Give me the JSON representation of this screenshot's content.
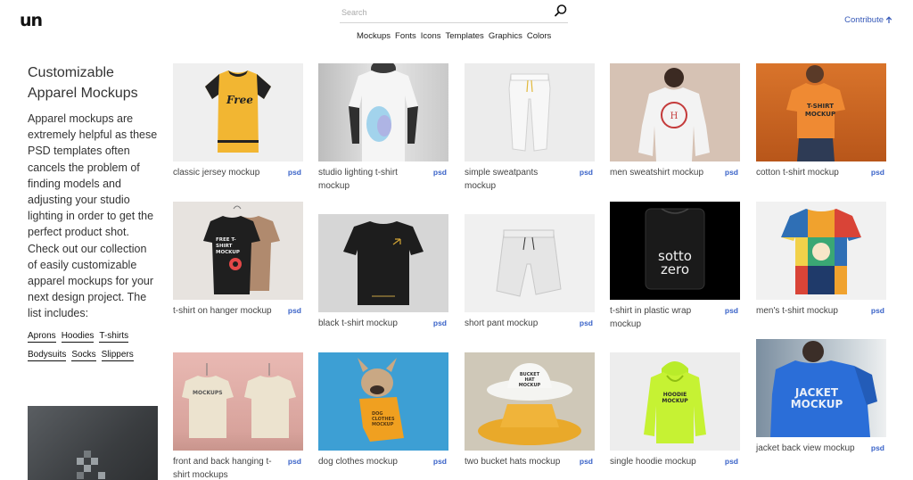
{
  "header": {
    "logo": "un",
    "search_placeholder": "Search",
    "nav": [
      "Mockups",
      "Fonts",
      "Icons",
      "Templates",
      "Graphics",
      "Colors"
    ],
    "contribute": "Contribute"
  },
  "sidebar": {
    "title": "Customizable Apparel Mockups",
    "description": "Apparel mockups are extremely helpful as these PSD templates often cancels the problem of finding models and adjusting your studio lighting in order to get the perfect product shot. Check out our collection of easily customizable apparel mockups for your next design project. The list includes:",
    "tags": [
      "Aprons",
      "Hoodies",
      "T-shirts",
      "Bodysuits",
      "Socks",
      "Slippers"
    ]
  },
  "grid": {
    "badge": "psd",
    "items": [
      {
        "caption": "classic jersey mockup",
        "print": "Free"
      },
      {
        "caption": "studio lighting t-shirt mockup",
        "print": ""
      },
      {
        "caption": "simple sweatpants mockup",
        "print": ""
      },
      {
        "caption": "men sweatshirt mockup",
        "print": ""
      },
      {
        "caption": "cotton t-shirt mockup",
        "print": "T-SHIRT MOCKUP"
      },
      {
        "caption": "t-shirt on hanger mockup",
        "print": "FREE T-SHIRT MOCKUP"
      },
      {
        "caption": "black t-shirt mockup",
        "print": ""
      },
      {
        "caption": "short pant mockup",
        "print": ""
      },
      {
        "caption": "t-shirt in plastic wrap mockup",
        "print": "sotto zero"
      },
      {
        "caption": "men's t-shirt mockup",
        "print": ""
      },
      {
        "caption": "front and back hanging t-shirt mockups",
        "print": "MOCKUPS"
      },
      {
        "caption": "dog clothes mockup",
        "print": "DOG CLOTHES MOCKUP"
      },
      {
        "caption": "two bucket hats mockup",
        "print": "BUCKET HAT MOCKUP"
      },
      {
        "caption": "single hoodie mockup",
        "print": "HOODIE MOCKUP"
      },
      {
        "caption": "jacket back view mockup",
        "print": "JACKET MOCKUP"
      }
    ]
  }
}
